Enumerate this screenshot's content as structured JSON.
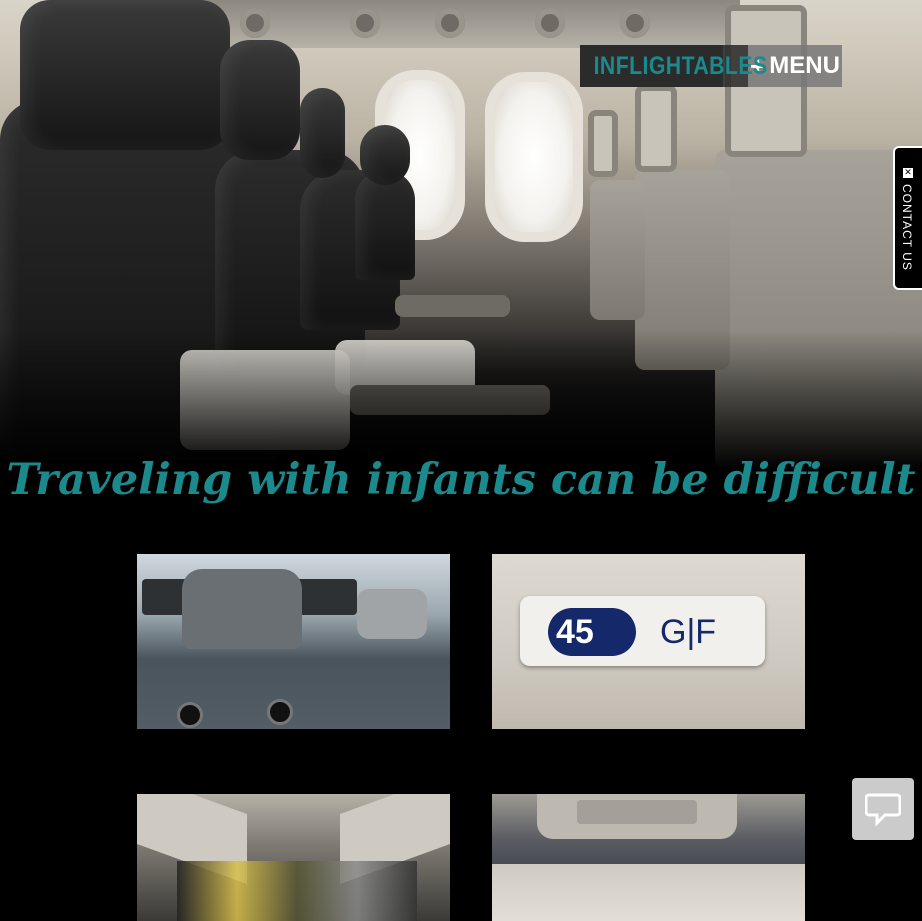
{
  "brand": {
    "name": "INFLIGHTABLES",
    "color": "#1a8a8d"
  },
  "menu": {
    "icon": "plus-icon",
    "label": "MENU"
  },
  "contact_tab": {
    "close_icon": "close-icon",
    "label": "CONTACT US"
  },
  "headline": "Traveling with infants can be difficult",
  "gallery": [
    {
      "subject": "stroller-with-car-seat-in-airport-gate"
    },
    {
      "subject": "seat-row-tag",
      "tag_number": "45",
      "tag_letters": "G|F"
    },
    {
      "subject": "crowded-airplane-aisle"
    },
    {
      "subject": "seat-back-entertainment-screen"
    }
  ],
  "chat": {
    "icon": "chat-bubble-icon"
  }
}
